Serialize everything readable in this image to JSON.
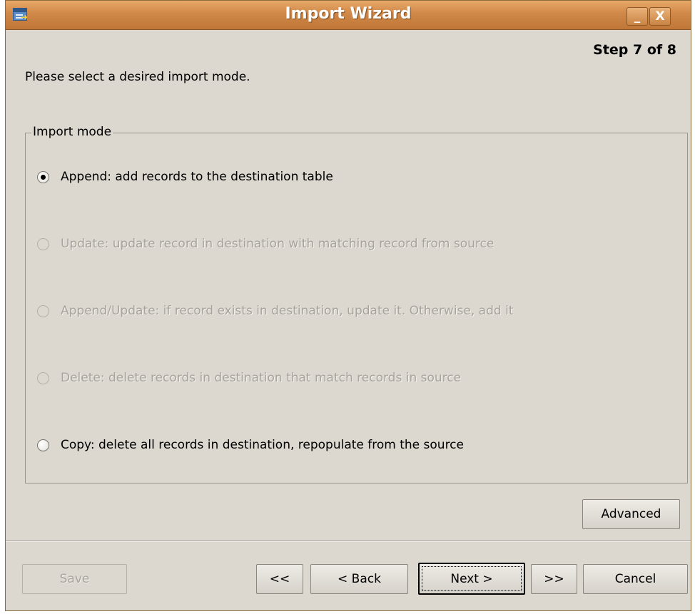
{
  "window": {
    "title": "Import Wizard",
    "minimize_icon": "_",
    "close_icon": "X"
  },
  "step": "Step 7 of 8",
  "instruction": "Please select a desired import mode.",
  "import_mode": {
    "label": "Import mode",
    "options": [
      {
        "label": "Append: add records to the destination table",
        "selected": true,
        "enabled": true
      },
      {
        "label": "Update: update record in destination with matching record from source",
        "selected": false,
        "enabled": false
      },
      {
        "label": "Append/Update: if record exists in destination, update it. Otherwise, add it",
        "selected": false,
        "enabled": false
      },
      {
        "label": "Delete: delete records in destination that match records in source",
        "selected": false,
        "enabled": false
      },
      {
        "label": "Copy: delete all records in destination, repopulate from the source",
        "selected": false,
        "enabled": true
      }
    ]
  },
  "buttons": {
    "advanced": "Advanced",
    "save": "Save",
    "first": "<<",
    "back": "< Back",
    "next": "Next >",
    "last": ">>",
    "cancel": "Cancel"
  }
}
